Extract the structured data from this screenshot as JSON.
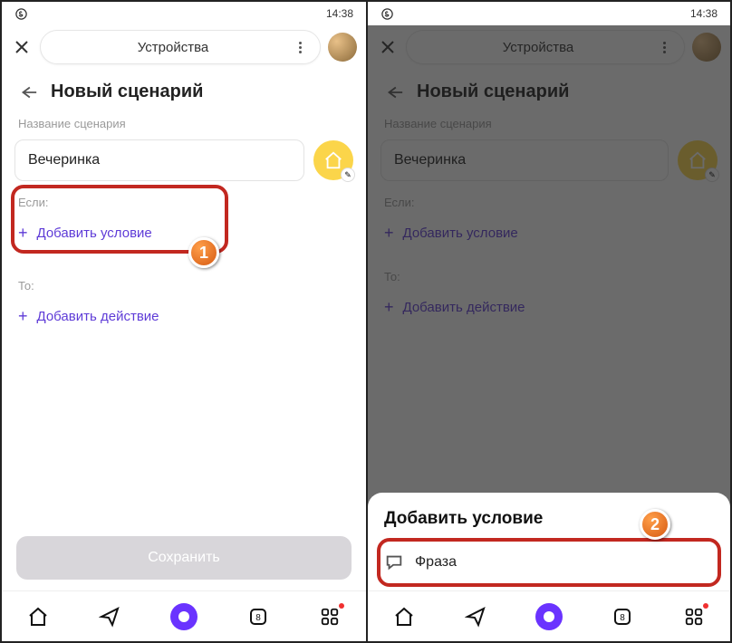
{
  "status": {
    "time": "14:38"
  },
  "header": {
    "title": "Устройства"
  },
  "page": {
    "back_title": "Новый сценарий"
  },
  "name": {
    "label": "Название сценария",
    "value": "Вечеринка"
  },
  "if": {
    "label": "Если:",
    "add": "Добавить условие"
  },
  "then": {
    "label": "То:",
    "add": "Добавить действие"
  },
  "save": "Сохранить",
  "sheet": {
    "title": "Добавить условие",
    "phrase": "Фраза"
  },
  "callouts": {
    "one": "1",
    "two": "2"
  }
}
